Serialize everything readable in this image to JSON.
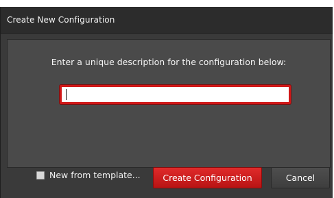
{
  "dialog": {
    "title": "Create New Configuration",
    "prompt": "Enter a unique description for the configuration below:",
    "input": {
      "value": "",
      "placeholder": ""
    },
    "template_checkbox": {
      "label": "New from template...",
      "checked": false
    },
    "create_button_label": "Create Configuration",
    "cancel_button_label": "Cancel"
  },
  "colors": {
    "accent": "#d01818",
    "dialog_bg": "#3a3a3a",
    "panel_bg": "#4a4a4a"
  }
}
